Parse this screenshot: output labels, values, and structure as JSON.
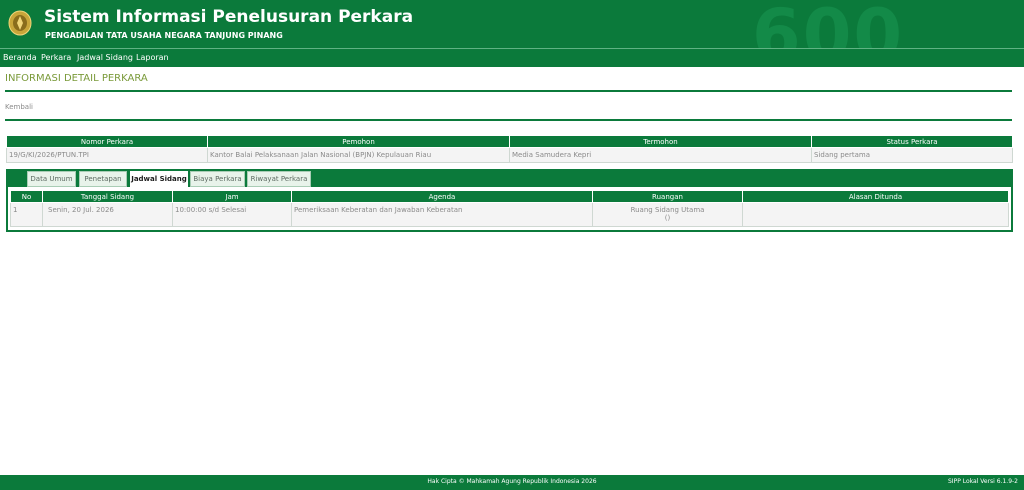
{
  "header": {
    "title": "Sistem Informasi Penelusuran Perkara",
    "subtitle": "PENGADILAN TATA USAHA NEGARA TANJUNG PINANG",
    "bg_number": "600",
    "brand_color": "#0b7a3b"
  },
  "nav": [
    {
      "label": "Beranda"
    },
    {
      "label": "Perkara"
    },
    {
      "label": "Jadwal Sidang"
    },
    {
      "label": "Laporan"
    }
  ],
  "page": {
    "heading": "INFORMASI DETAIL PERKARA",
    "back_label": "Kembali"
  },
  "case": {
    "headers": [
      "Nomor Perkara",
      "Pemohon",
      "Termohon",
      "Status Perkara"
    ],
    "row": [
      "19/G/KI/2026/PTUN.TPI",
      "Kantor Balai Pelaksanaan Jalan Nasional (BPJN) Kepulauan Riau",
      "Media Samudera Kepri",
      "Sidang pertama"
    ]
  },
  "tabs": [
    {
      "label": "Data Umum"
    },
    {
      "label": "Penetapan"
    },
    {
      "label": "Jadwal Sidang",
      "active": true
    },
    {
      "label": "Biaya Perkara"
    },
    {
      "label": "Riwayat Perkara"
    }
  ],
  "schedule": {
    "headers": [
      "No",
      "Tanggal Sidang",
      "Jam",
      "Agenda",
      "Ruangan",
      "Alasan Ditunda"
    ],
    "rows": [
      {
        "no": "1",
        "tanggal": "Senin, 20 Jul. 2026",
        "jam": "10:00:00 s/d Selesai",
        "agenda": "Pemeriksaan Keberatan dan Jawaban Keberatan",
        "ruangan": "Ruang Sidang Utama",
        "ruangan_extra": "()",
        "alasan": ""
      }
    ]
  },
  "footer": {
    "copyright": "Hak Cipta © Mahkamah Agung Republik Indonesia 2026",
    "version": "SIPP Lokal Versi 6.1.9-2"
  }
}
